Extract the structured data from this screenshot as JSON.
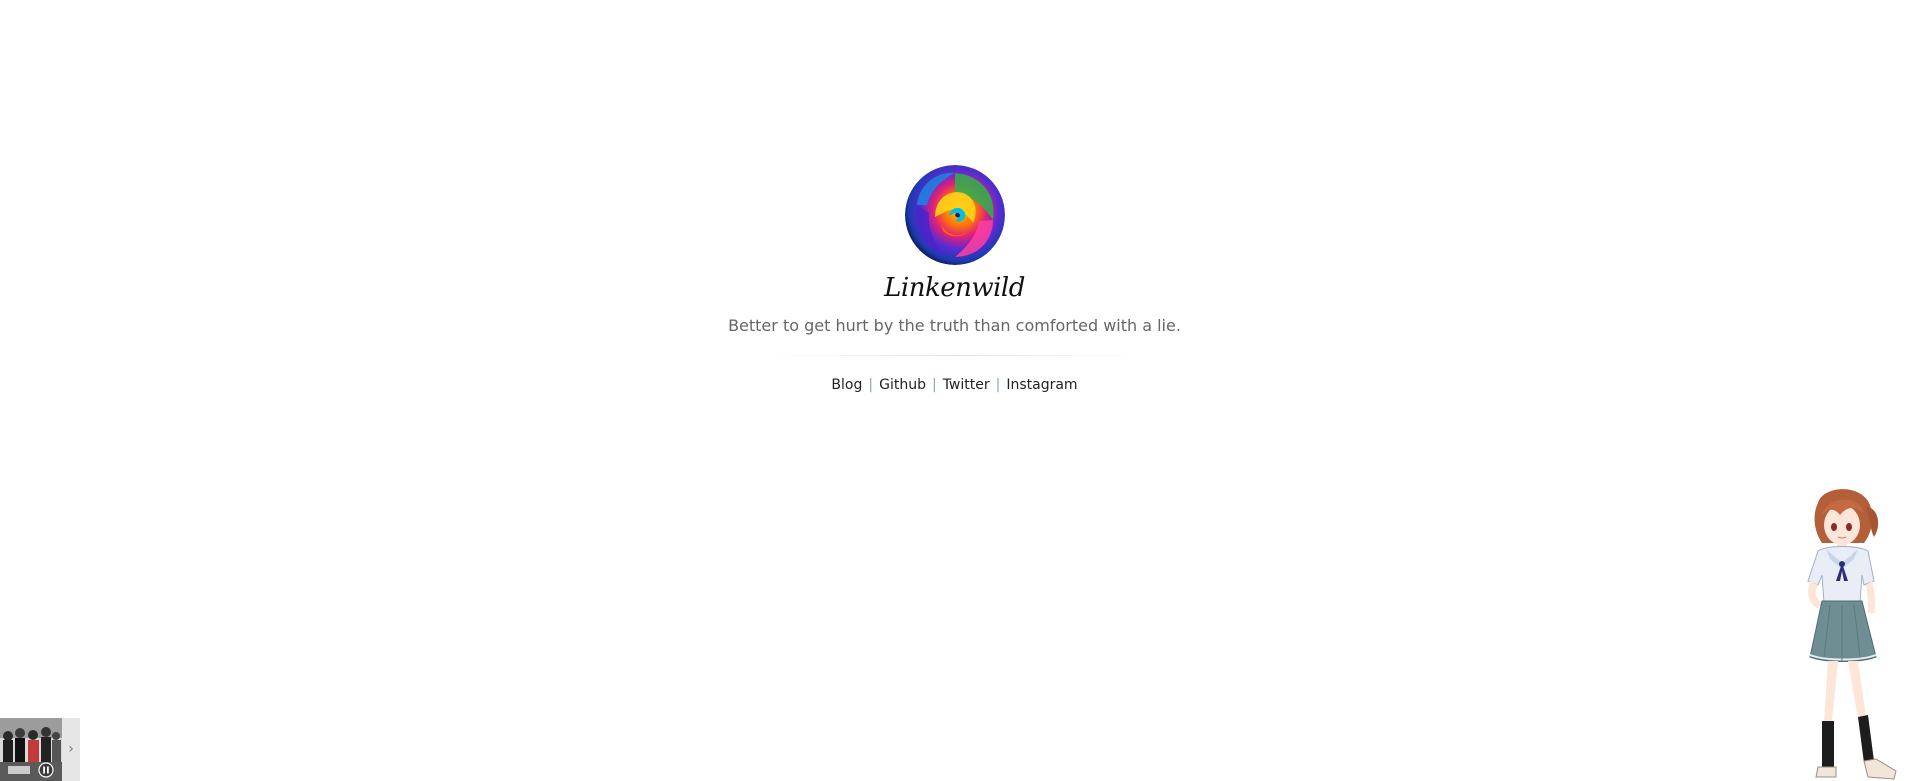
{
  "profile": {
    "avatar_icon": "rainbow-rose-icon",
    "site_name": "Linkenwild",
    "tagline": "Better to get hurt by the truth than comforted with a lie."
  },
  "links": [
    {
      "label": "Blog"
    },
    {
      "label": "Github"
    },
    {
      "label": "Twitter"
    },
    {
      "label": "Instagram"
    }
  ],
  "link_separator": "|",
  "music_player": {
    "state_icon": "pause-icon",
    "toggle_icon": "chevron-right-icon",
    "toggle_glyph": "›"
  },
  "mascot": {
    "icon": "anime-girl-mascot-icon"
  },
  "colors": {
    "tagline": "#666666",
    "separator": "#8aa6c8"
  }
}
